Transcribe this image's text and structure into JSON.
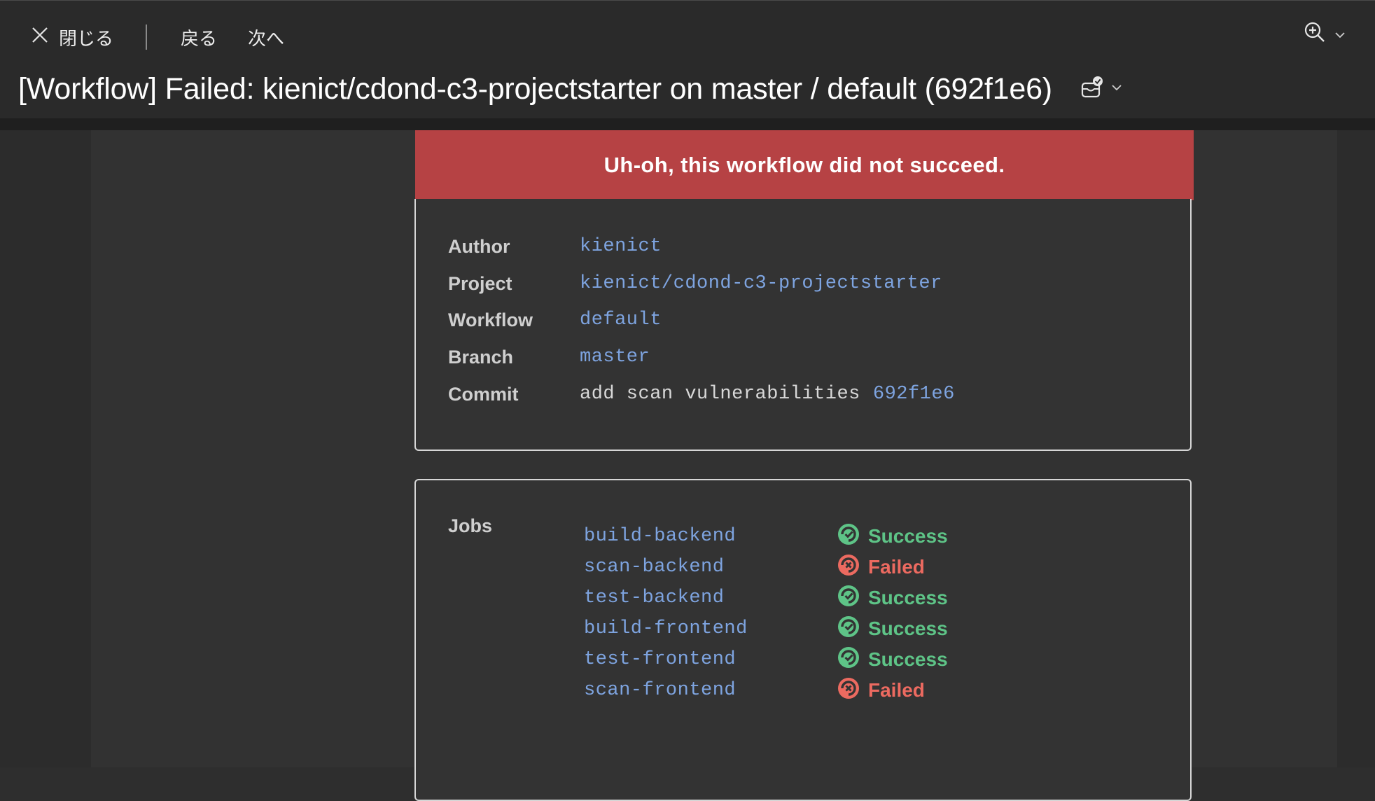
{
  "toolbar": {
    "close_label": "閉じる",
    "back_label": "戻る",
    "next_label": "次へ"
  },
  "subject": "[Workflow] Failed: kienict/cdond-c3-projectstarter on master / default (692f1e6)",
  "banner": "Uh-oh, this workflow did not succeed.",
  "details": {
    "author_label": "Author",
    "author_value": "kienict",
    "project_label": "Project",
    "project_value": "kienict/cdond-c3-projectstarter",
    "workflow_label": "Workflow",
    "workflow_value": "default",
    "branch_label": "Branch",
    "branch_value": "master",
    "commit_label": "Commit",
    "commit_message": "add scan vulnerabilities",
    "commit_hash": "692f1e6"
  },
  "jobs_label": "Jobs",
  "jobs": [
    {
      "name": "build-backend",
      "status": "Success"
    },
    {
      "name": "scan-backend",
      "status": "Failed"
    },
    {
      "name": "test-backend",
      "status": "Success"
    },
    {
      "name": "build-frontend",
      "status": "Success"
    },
    {
      "name": "test-frontend",
      "status": "Success"
    },
    {
      "name": "scan-frontend",
      "status": "Failed"
    }
  ],
  "colors": {
    "banner_bg": "#b64244",
    "link": "#7ea4e0",
    "success": "#5ec487",
    "failed": "#ec6a60"
  },
  "icons": [
    "close-icon",
    "zoom-in-icon",
    "chevron-down-icon",
    "flag-icon",
    "success-icon",
    "failed-icon"
  ]
}
